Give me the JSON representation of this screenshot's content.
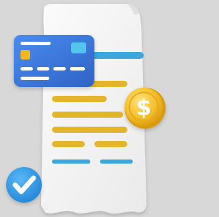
{
  "illustration": {
    "subject": "payment-receipt",
    "icons": [
      "credit-card-icon",
      "receipt-icon",
      "dollar-coin-icon",
      "check-badge-icon"
    ],
    "coin_symbol": "$"
  },
  "colors": {
    "background": "#d8d8d8",
    "receipt_paper": "#f4f4f4",
    "receipt_shadow": "#cfcfcf",
    "card_blue": "#3f7ddc",
    "card_blue_dark": "#2f66c6",
    "card_chip": "#f4b81c",
    "card_logo": "#53c6ee",
    "line_blue": "#3aa7dd",
    "line_gold": "#e3b52a",
    "coin_gold": "#f2c230",
    "coin_edge": "#d99f10",
    "check_blue": "#2f9be2"
  }
}
